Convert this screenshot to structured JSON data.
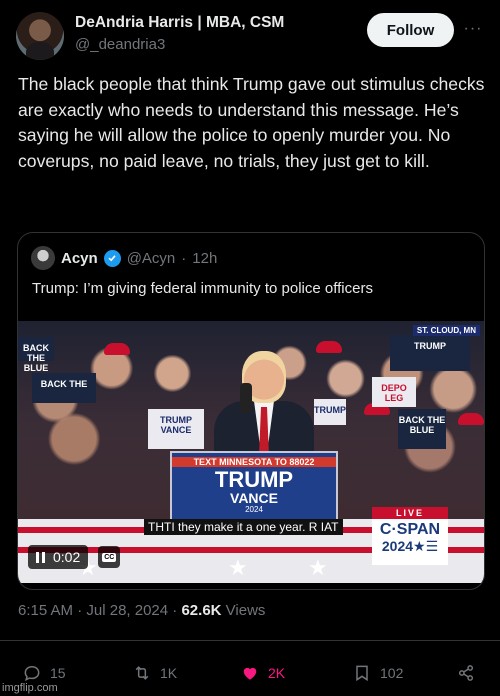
{
  "author": {
    "name": "DeAndria Harris | MBA, CSM",
    "handle": "@_deandria3",
    "avatar_icon": "profile-photo"
  },
  "follow_label": "Follow",
  "more_label": "···",
  "tweet": {
    "text": "The black people that think Trump gave out stimulus checks are exactly who needs to understand this message. He’s saying he will allow the police to openly murder you. No coverups, no paid leave, no trials, they just get to kill."
  },
  "quote": {
    "name": "Acyn",
    "handle": "@Acyn",
    "separator": "·",
    "time": "12h",
    "verified_color": "#1d9bf0",
    "text": "Trump: I’m giving federal immunity to police officers",
    "video": {
      "location": "ST. CLOUD, MN",
      "podium_top": "TEXT MINNESOTA TO 88022",
      "podium_trump": "TRUMP",
      "podium_vance": "VANCE",
      "podium_year": "2024",
      "caption": "THTI they make it a one year. R IAT",
      "live": "LIVE",
      "network": "C·SPAN",
      "network_year": "2024★☰",
      "time": "0:02",
      "cc_label": "CC",
      "signs": [
        "BACK THE BLUE",
        "BACK THE",
        "TRUMP VANCE",
        "TRUMP",
        "BACK THE BLUE",
        "DEPO LEG",
        "TRUMP"
      ]
    }
  },
  "meta": {
    "time": "6:15 AM",
    "dot": "·",
    "date": "Jul 28, 2024",
    "views_count": "62.6K",
    "views_label": "Views"
  },
  "actions": {
    "replies": "15",
    "retweets": "1K",
    "likes": "2K",
    "bookmarks": "102",
    "like_color": "#f91880"
  },
  "watermark": "imgflip.com"
}
